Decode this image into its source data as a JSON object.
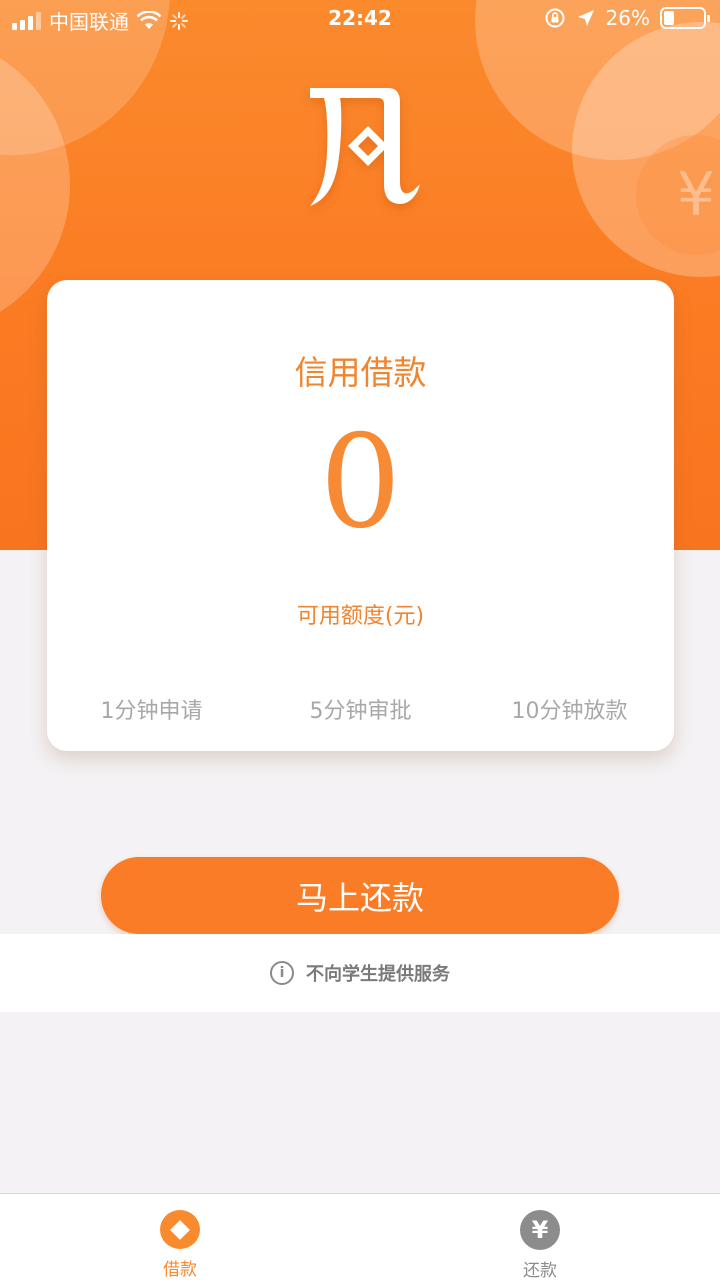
{
  "status_bar": {
    "carrier": "中国联通",
    "time": "22:42",
    "battery_percent": "26%",
    "battery_level": 0.26
  },
  "card": {
    "title": "信用借款",
    "amount": "0",
    "amount_label": "可用额度(元)",
    "steps": [
      "1分钟申请",
      "5分钟审批",
      "10分钟放款"
    ]
  },
  "action": {
    "repay_label": "马上还款"
  },
  "notice": {
    "text": "不向学生提供服务",
    "icon": "info-icon"
  },
  "tabs": [
    {
      "label": "借款",
      "icon": "diamond-coin-icon",
      "active": true
    },
    {
      "label": "还款",
      "icon": "yen-icon",
      "active": false
    }
  ],
  "colors": {
    "accent": "#fb7c27",
    "text_accent": "#f0842f",
    "muted": "#a8a8a8",
    "background": "#f4f2f4"
  }
}
